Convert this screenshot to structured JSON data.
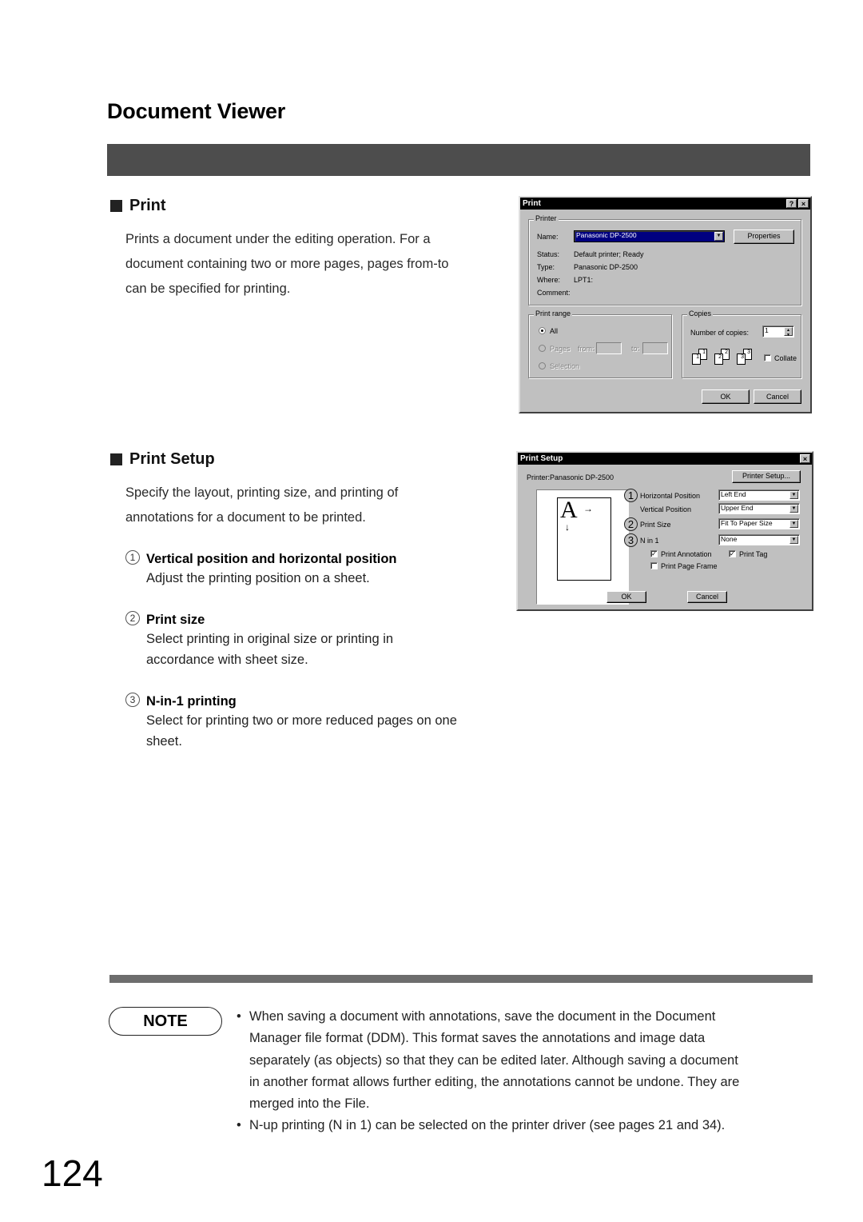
{
  "page": {
    "title": "Document Viewer",
    "page_number": "124"
  },
  "print_section": {
    "heading": "Print",
    "description": [
      "Prints a document under the editing operation.  For a",
      "document containing two or more pages, pages from-to",
      "can be specified for printing."
    ]
  },
  "print_dialog": {
    "title": "Print",
    "help_btn": "?",
    "close_btn": "×",
    "printer_group": "Printer",
    "name_label": "Name:",
    "name_value": "Panasonic DP-2500",
    "properties_btn": "Properties",
    "status_label": "Status:",
    "status_value": "Default printer; Ready",
    "type_label": "Type:",
    "type_value": "Panasonic DP-2500",
    "where_label": "Where:",
    "where_value": "LPT1:",
    "comment_label": "Comment:",
    "range_group": "Print range",
    "all_label": "All",
    "pages_label": "Pages",
    "from_label": "from:",
    "to_label": "to:",
    "selection_label": "Selection",
    "copies_group": "Copies",
    "copies_label": "Number of copies:",
    "copies_value": "1",
    "collate_label": "Collate",
    "collate_pages": [
      "1",
      "1",
      "2",
      "2",
      "3",
      "3"
    ],
    "ok_btn": "OK",
    "cancel_btn": "Cancel"
  },
  "setup_section": {
    "heading": "Print Setup",
    "description": [
      "Specify the layout, printing size, and printing of",
      "annotations for a document to be printed."
    ],
    "items": [
      {
        "num": "1",
        "title": "Vertical position and horizontal position",
        "desc": [
          "Adjust the printing position on a sheet."
        ]
      },
      {
        "num": "2",
        "title": "Print size",
        "desc": [
          "Select printing in original size or printing in",
          "accordance with sheet size."
        ]
      },
      {
        "num": "3",
        "title": "N-in-1 printing",
        "desc": [
          "Select for printing two or more reduced pages on one",
          "sheet."
        ]
      }
    ]
  },
  "setup_dialog": {
    "title": "Print Setup",
    "close_btn": "×",
    "printer_text": "Printer:Panasonic DP-2500",
    "printer_setup_btn": "Printer Setup...",
    "preview_letter": "A",
    "preview_right_arrow": "→",
    "preview_down_arrow": "↓",
    "markers": [
      "1",
      "2",
      "3"
    ],
    "h_pos_label": "Horizontal Position",
    "h_pos_value": "Left End",
    "v_pos_label": "Vertical Position",
    "v_pos_value": "Upper End",
    "size_label": "Print Size",
    "size_value": "Fit To Paper Size",
    "nin1_label": "N in 1",
    "nin1_value": "None",
    "annotation_label": "Print Annotation",
    "annotation_checked": true,
    "tag_label": "Print Tag",
    "tag_checked": true,
    "frame_label": "Print Page Frame",
    "frame_checked": false,
    "check_mark": "✓",
    "ok_btn": "OK",
    "cancel_btn": "Cancel"
  },
  "note": {
    "badge": "NOTE",
    "bullet": "•",
    "items": [
      [
        "When saving a document with annotations, save the document in the Document",
        "Manager file format (DDM).  This format saves the annotations and image data",
        "separately (as objects) so that they can be edited later.  Although saving a document",
        "in another format allows further editing, the annotations cannot be undone.  They are",
        "merged into the File."
      ],
      [
        "N-up printing (N in 1) can be selected on the printer driver (see pages 21 and  34)."
      ]
    ]
  },
  "colors": {
    "title_bar": "#4d4d4d",
    "footer_bar": "#6d6d6d",
    "dialog_face": "#c0c0c0",
    "dialog_titlebar": "#000000"
  }
}
